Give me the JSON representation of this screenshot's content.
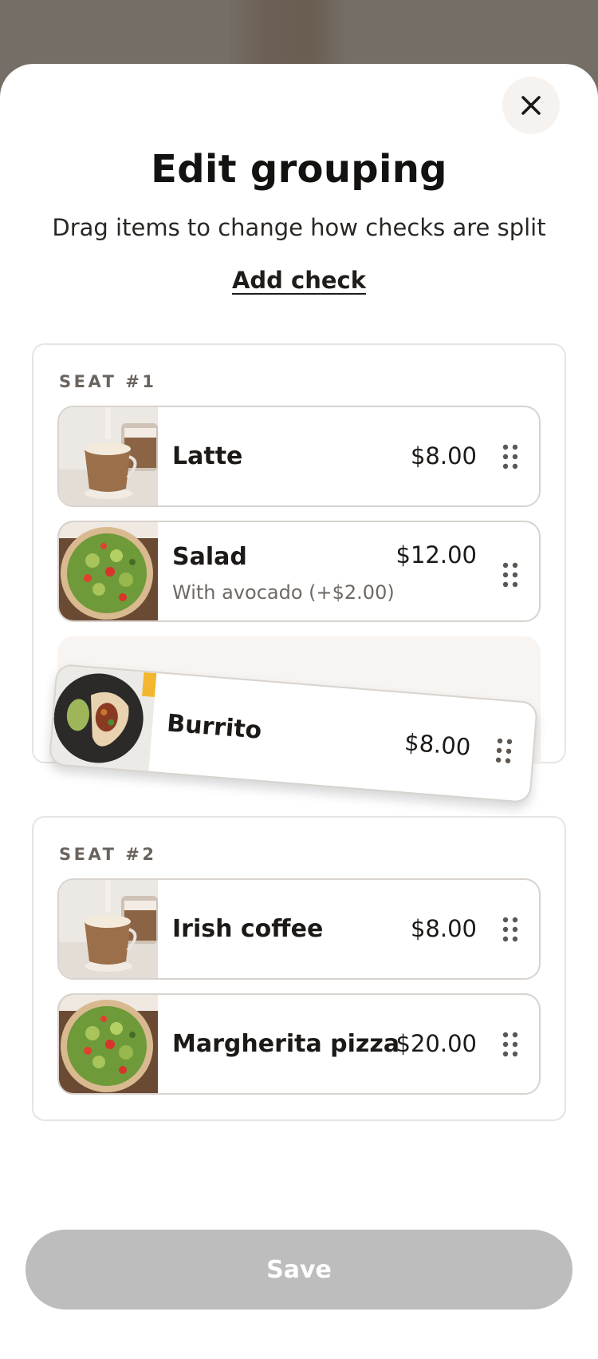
{
  "sheet": {
    "title": "Edit grouping",
    "subtitle": "Drag items to change how checks are split",
    "add_check_label": "Add check",
    "close_icon": "close-icon"
  },
  "groups": [
    {
      "label": "SEAT #1",
      "items": [
        {
          "name": "Latte",
          "price": "$8.00",
          "image": "coffee",
          "drag_icon": "drag-handle-icon"
        },
        {
          "name": "Salad",
          "price": "$12.00",
          "modifier": "With avocado (+$2.00)",
          "image": "salad",
          "drag_icon": "drag-handle-icon"
        }
      ]
    },
    {
      "label": "SEAT #2",
      "items": [
        {
          "name": "Irish coffee",
          "price": "$8.00",
          "image": "coffee",
          "drag_icon": "drag-handle-icon"
        },
        {
          "name": "Margherita pizza",
          "price": "$20.00",
          "image": "salad",
          "drag_icon": "drag-handle-icon"
        }
      ]
    }
  ],
  "dragging_item": {
    "name": "Burrito",
    "price": "$8.00",
    "image": "burrito",
    "drag_icon": "drag-handle-icon"
  },
  "footer": {
    "save_label": "Save",
    "save_disabled": true
  },
  "colors": {
    "save_disabled_bg": "#bdbdbd",
    "placeholder_bg": "#f7f4f2",
    "close_bg": "#f6f2ef"
  }
}
